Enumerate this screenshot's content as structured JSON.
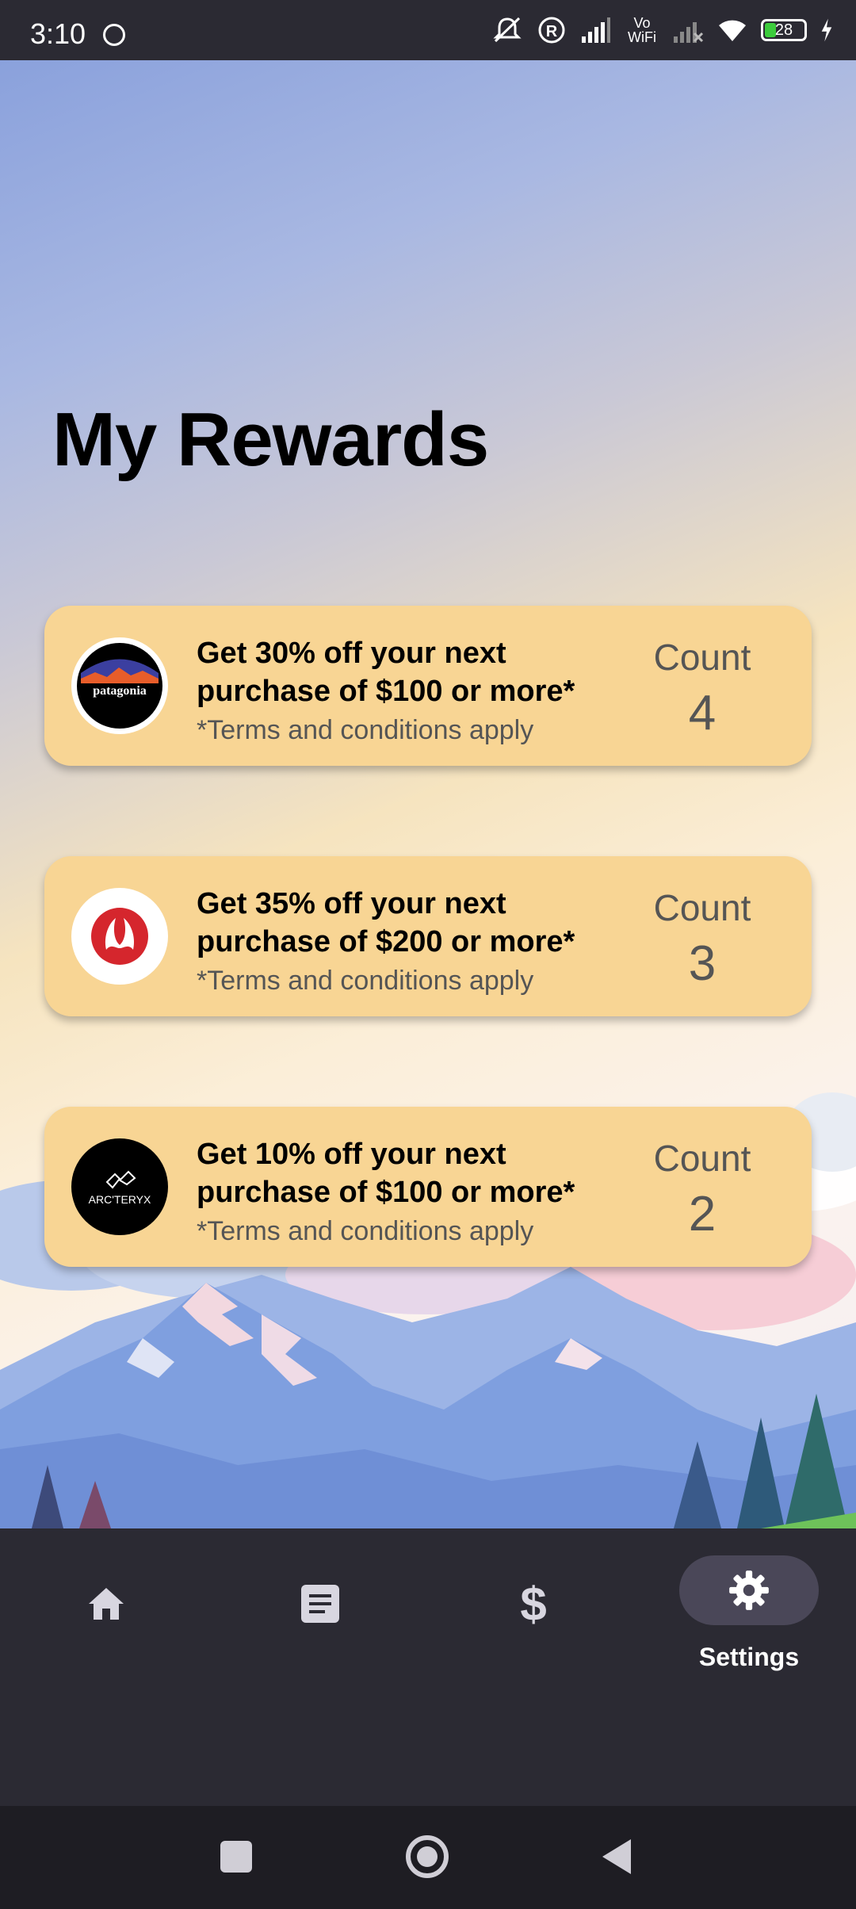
{
  "status_bar": {
    "time": "3:10",
    "icons": [
      "mute-icon",
      "registered-icon",
      "signal-icon",
      "vowifi-icon",
      "no-signal-icon",
      "wifi-icon",
      "battery-icon",
      "charging-icon"
    ],
    "vowifi_label_top": "Vo",
    "vowifi_label_bottom": "WiFi",
    "battery": "28"
  },
  "page": {
    "title": "My Rewards"
  },
  "rewards": [
    {
      "brand": "patagonia",
      "headline_line1": "Get 30% off your next",
      "headline_line2": "purchase of $100 or more*",
      "terms": "*Terms and conditions apply",
      "count_label": "Count",
      "count": "4"
    },
    {
      "brand": "lululemon",
      "headline_line1": "Get 35% off your next",
      "headline_line2": "purchase of $200 or more*",
      "terms": "*Terms and conditions apply",
      "count_label": "Count",
      "count": "3"
    },
    {
      "brand": "ARC'TERYX",
      "headline_line1": "Get 10% off your next",
      "headline_line2": "purchase of $100 or more*",
      "terms": "*Terms and conditions apply",
      "count_label": "Count",
      "count": "2"
    }
  ],
  "bottom_nav": {
    "items": [
      {
        "icon": "home-icon"
      },
      {
        "icon": "document-icon"
      },
      {
        "icon": "dollar-icon",
        "glyph": "$"
      },
      {
        "icon": "gear-icon",
        "label": "Settings",
        "active": true
      }
    ]
  },
  "system_nav": {
    "icons": [
      "recents-icon",
      "home-circle-icon",
      "back-icon"
    ]
  },
  "colors": {
    "card": "#f8d594",
    "nav_bg": "#2b2a33",
    "active_pill": "#4a4758",
    "text_muted": "#555555"
  }
}
